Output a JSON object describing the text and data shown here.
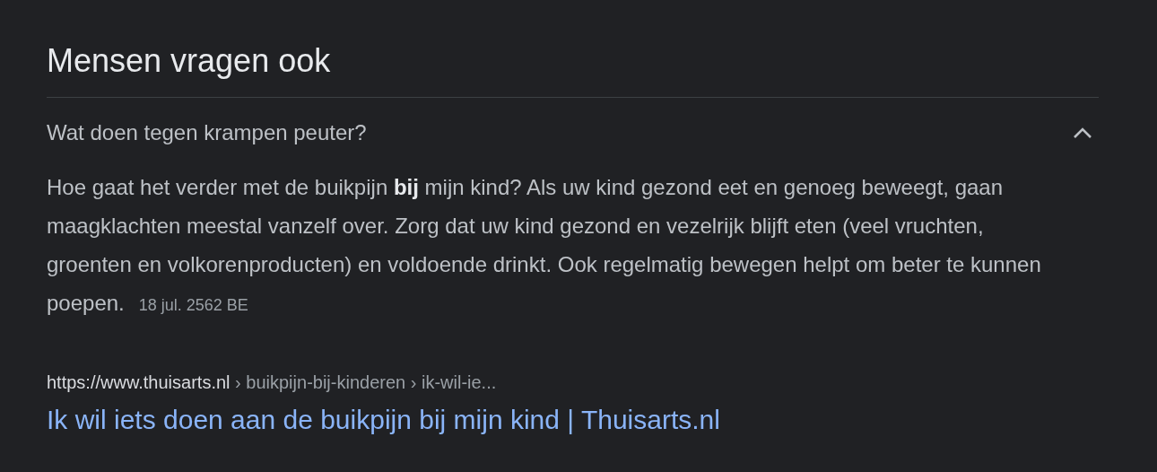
{
  "heading": "Mensen vragen ook",
  "questions": [
    {
      "question": "Wat doen tegen krampen peuter?",
      "expanded": true,
      "answer": "Hoe gaat het verder met de buikpijn **bij** mijn kind? Als uw kind gezond eet en genoeg beweegt, gaan maagklachten meestal vanzelf over. Zorg dat uw kind gezond en vezelrijk blijft eten (veel vruchten, groenten en volkorenproducten) en voldoende drinkt. Ook regelmatig bewegen helpt om beter te kunnen poepen.",
      "date": "18 jul. 2562 BE",
      "source_url": "https://www.thuisarts.nl",
      "source_path": " › buikpijn-bij-kinderen › ik-wil-ie...",
      "result_title": "Ik wil iets doen aan de buikpijn bij mijn kind | Thuisarts.nl"
    }
  ]
}
